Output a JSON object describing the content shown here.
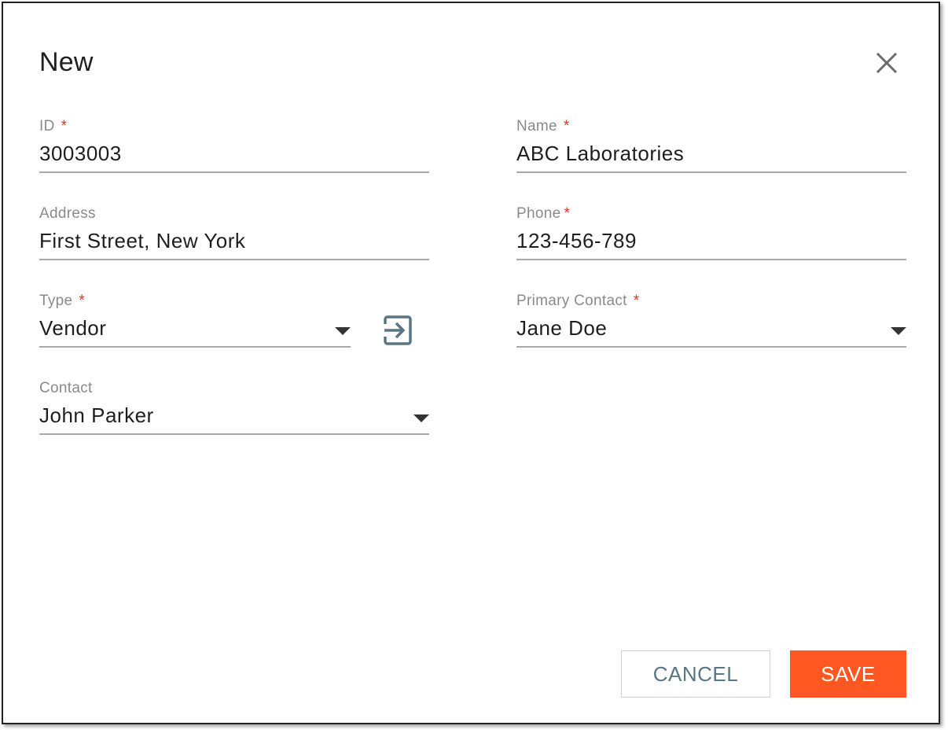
{
  "dialog": {
    "title": "New",
    "close_icon": "close-icon"
  },
  "fields": {
    "id": {
      "label": "ID",
      "required_mark": "*",
      "value": "3003003"
    },
    "name": {
      "label": "Name",
      "required_mark": "*",
      "value": "ABC Laboratories"
    },
    "address": {
      "label": "Address",
      "value": "First Street, New York"
    },
    "phone": {
      "label": "Phone",
      "required_mark": "*",
      "value": "123-456-789"
    },
    "type": {
      "label": "Type",
      "required_mark": "*",
      "value": "Vendor"
    },
    "primary_contact": {
      "label": "Primary Contact",
      "required_mark": "*",
      "value": "Jane Doe"
    },
    "contact": {
      "label": "Contact",
      "value": "John Parker"
    }
  },
  "actions": {
    "cancel_label": "CANCEL",
    "save_label": "SAVE"
  },
  "colors": {
    "accent": "#ff5722",
    "required": "#e0352b",
    "cancel_text": "#5a7583",
    "link_icon": "#5a7583"
  }
}
